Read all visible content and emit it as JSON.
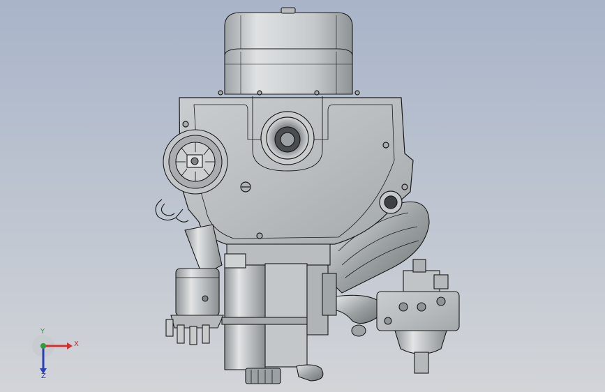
{
  "triad": {
    "x_label": "X",
    "y_label": "Y",
    "z_label": "Z",
    "x_color": "#d32f2f",
    "y_color": "#2e9b3a",
    "z_color": "#2b3fb8"
  },
  "model": {
    "shade_light": "#d9dcdd",
    "shade_mid": "#b8bcbe",
    "shade_dark": "#8c9194",
    "edge_color": "#1a1a1a"
  }
}
